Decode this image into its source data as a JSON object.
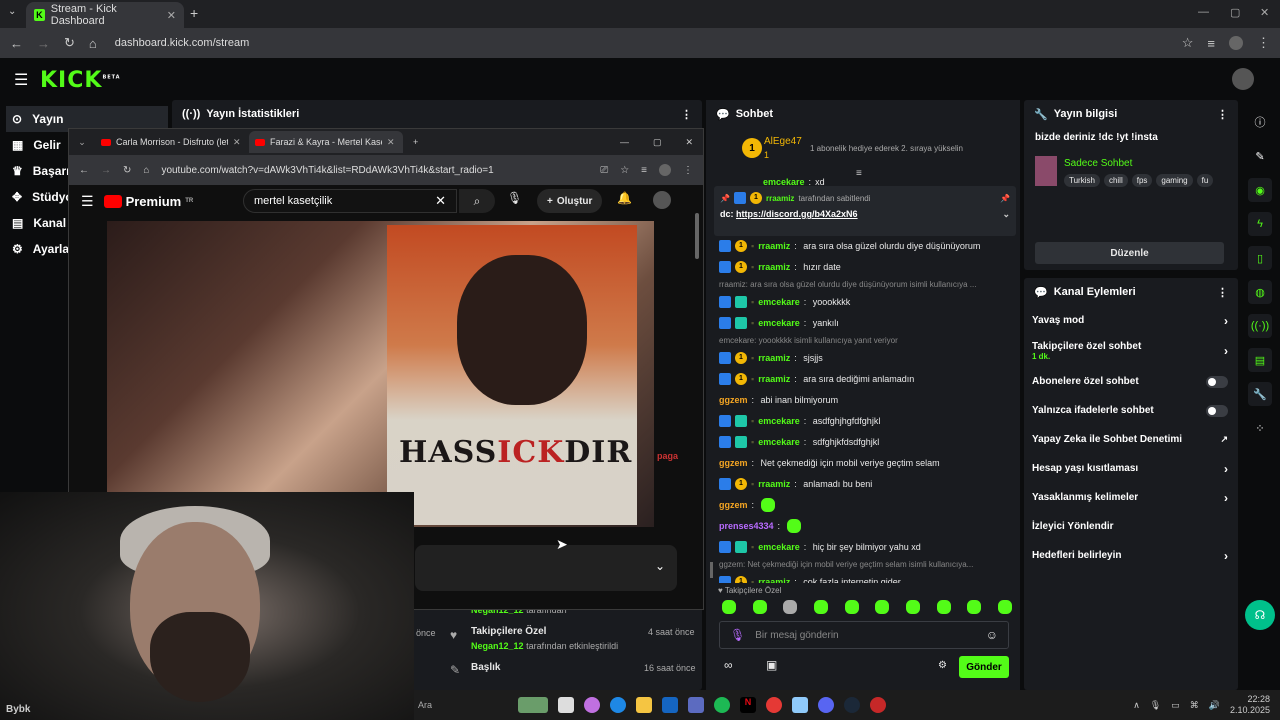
{
  "browser": {
    "tab_title": "Stream - Kick Dashboard",
    "url": "dashboard.kick.com/stream"
  },
  "kick": {
    "logo": "KICK",
    "logo_badge": "BETA",
    "nav": [
      "Yayın",
      "Gelir",
      "Başarı",
      "Stüdyo",
      "Kanal",
      "Ayarla"
    ]
  },
  "stats_panel": {
    "title": "Yayın İstatistikleri"
  },
  "youtube_window": {
    "tab1": "Carla Morrison - Disfruto (letra)",
    "tab2": "Farazi & Kayra - Mertel Kasetçilik",
    "url": "youtube.com/watch?v=dAWk3VhTi4k&list=RDdAWk3VhTi4k&start_radio=1",
    "brand": "Premium",
    "brand_sup": "TR",
    "search": "mertel kasetçilik",
    "create_label": "Oluştur",
    "cd_text_1": "HASS",
    "cd_text_2": "ICK",
    "cd_text_3": "DIR",
    "side_logo": "paga"
  },
  "activity": {
    "items": [
      {
        "user": "Negan12_12",
        "suffix": "tarafından",
        "title": "",
        "time": ""
      },
      {
        "title": "Takipçilere Özel",
        "user": "Negan12_12",
        "suffix": "tarafından etkinleştirildi",
        "time": "4 saat önce"
      },
      {
        "title": "Başlık",
        "time": "16 saat önce"
      }
    ],
    "partial_time": "önce"
  },
  "chat": {
    "title": "Sohbet",
    "top_user": "AlEge47",
    "top_rank": "1",
    "top_sub_count": "1",
    "top_notice": "1 abonelik hediye ederek 2. sıraya yükselin",
    "pinned_by": "rraamiz",
    "pinned_by_suffix": "tarafından sabitlendi",
    "pinned_prefix": "dc:",
    "pinned_link": "https://discord.gg/b4Xa2xN6",
    "partial_msg": {
      "user": "emcekare",
      "text": "xd"
    },
    "messages": [
      {
        "user": "rraamiz",
        "color": "green",
        "badges": "byr",
        "text": "ara sıra olsa güzel olurdu diye düşünüyorum"
      },
      {
        "user": "rraamiz",
        "color": "green",
        "badges": "byr",
        "text": "hızır date"
      },
      {
        "reply": "rraamiz: ara sıra olsa güzel olurdu diye düşünüyorum isimli kullanıcıya ..."
      },
      {
        "user": "emcekare",
        "color": "green",
        "badges": "bgr",
        "text": "yoookkkk"
      },
      {
        "user": "emcekare",
        "color": "green",
        "badges": "bgr",
        "text": "yankılı"
      },
      {
        "reply": "emcekare: yoookkkk isimli kullanıcıya yanıt veriyor"
      },
      {
        "user": "rraamiz",
        "color": "green",
        "badges": "byr",
        "text": "sjsjjs"
      },
      {
        "user": "rraamiz",
        "color": "green",
        "badges": "byr",
        "text": "ara sıra dediğimi anlamadın"
      },
      {
        "user": "ggzem",
        "color": "orange",
        "badges": "",
        "text": "abi inan bilmiyorum"
      },
      {
        "user": "emcekare",
        "color": "green",
        "badges": "bgr",
        "text": "asdfghjhgfdfghjkl"
      },
      {
        "user": "emcekare",
        "color": "green",
        "badges": "bgr",
        "text": "sdfghjkfdsdfghjkl"
      },
      {
        "user": "ggzem",
        "color": "orange",
        "badges": "",
        "text": "Net çekmediği için mobil veriye geçtim selam"
      },
      {
        "user": "rraamiz",
        "color": "green",
        "badges": "byr",
        "text": "anlamadı bu beni"
      },
      {
        "user": "ggzem",
        "color": "orange",
        "badges": "",
        "text": "",
        "emote": true
      },
      {
        "user": "prenses4334",
        "color": "purple",
        "badges": "",
        "text": "",
        "emote": true
      },
      {
        "user": "emcekare",
        "color": "green",
        "badges": "bgr",
        "text": "hiç bir şey bilmiyor yahu xd"
      },
      {
        "reply": "ggzem: Net çekmediği için mobil veriye geçtim selam isimli kullanıcıya..."
      },
      {
        "user": "rraamiz",
        "color": "green",
        "badges": "byr",
        "text": "çok fazla internetin gider"
      }
    ],
    "followers_only": "Takipçilere Özel",
    "input_placeholder": "Bir mesaj gönderin",
    "send_label": "Gönder"
  },
  "stream_info": {
    "title": "Yayın bilgisi",
    "description": "bizde deriniz !dc !yt !insta",
    "category": "Sadece Sohbet",
    "tags": [
      "Turkish",
      "chill",
      "fps",
      "gaming",
      "fu"
    ],
    "edit_label": "Düzenle"
  },
  "channel_actions": {
    "title": "Kanal Eylemleri",
    "items": [
      {
        "label": "Yavaş mod",
        "type": "chevron"
      },
      {
        "label": "Takipçilere özel sohbet",
        "sub": "1 dk.",
        "type": "chevron"
      },
      {
        "label": "Abonelere özel sohbet",
        "type": "toggle"
      },
      {
        "label": "Yalnızca ifadelerle sohbet",
        "type": "toggle"
      },
      {
        "label": "Yapay Zeka ile Sohbet Denetimi",
        "type": "external"
      },
      {
        "label": "Hesap yaşı kısıtlaması",
        "type": "chevron"
      },
      {
        "label": "Yasaklanmış kelimeler",
        "type": "chevron"
      },
      {
        "label": "İzleyici Yönlendir",
        "type": "none"
      },
      {
        "label": "Hedefleri belirleyin",
        "type": "chevron"
      }
    ]
  },
  "taskbar": {
    "search": "Ara",
    "time": "22:28",
    "date": "2.10.2025"
  },
  "overlay_name": "Bybk"
}
